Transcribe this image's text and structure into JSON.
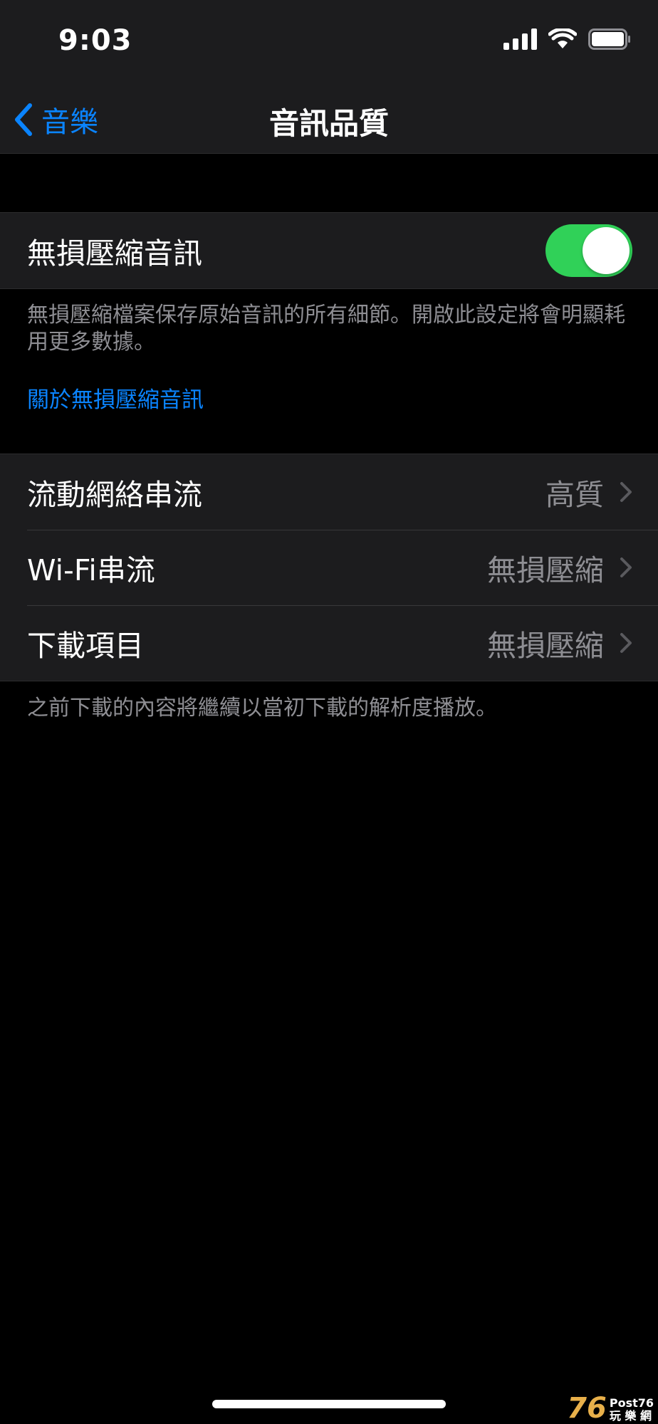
{
  "status_bar": {
    "time": "9:03"
  },
  "nav": {
    "back_label": "音樂",
    "title": "音訊品質"
  },
  "lossless": {
    "label": "無損壓縮音訊",
    "enabled": true,
    "description": "無損壓縮檔案保存原始音訊的所有細節。開啟此設定將會明顯耗用更多數據。",
    "link": "關於無損壓縮音訊"
  },
  "streaming": {
    "rows": [
      {
        "label": "流動網絡串流",
        "value": "高質"
      },
      {
        "label": "Wi-Fi串流",
        "value": "無損壓縮"
      },
      {
        "label": "下載項目",
        "value": "無損壓縮"
      }
    ],
    "footnote": "之前下載的內容將繼續以當初下載的解析度播放。"
  },
  "watermark": {
    "number": "76",
    "line1": "Post76",
    "line2": "玩 樂 網"
  },
  "colors": {
    "accent": "#0a84ff",
    "toggle_on": "#30d158",
    "cell_bg": "#1c1c1e",
    "secondary": "#8e8e93"
  }
}
